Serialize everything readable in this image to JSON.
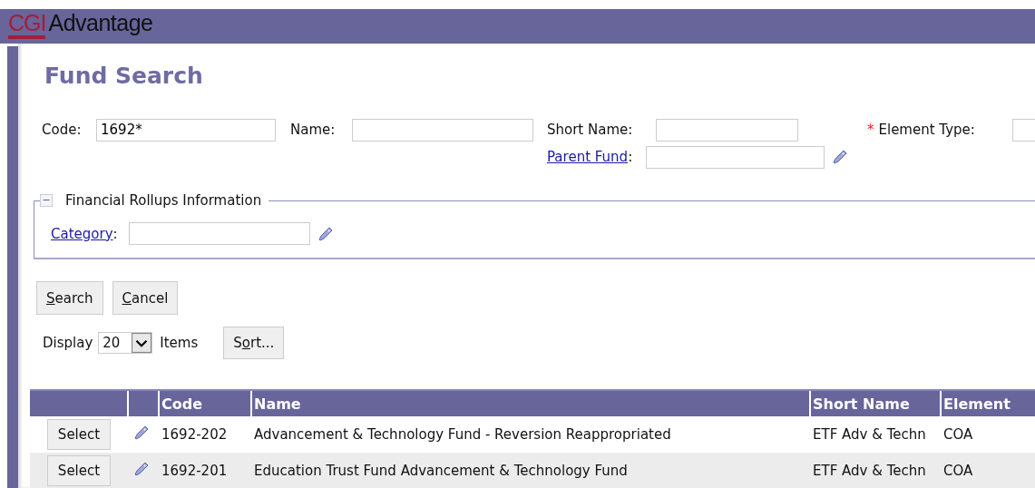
{
  "header": {
    "logo": "CGI",
    "product": "Advantage"
  },
  "title": "Fund Search",
  "search_fields": [
    {
      "kind": "text",
      "label": "Code:",
      "value": "1692*"
    },
    {
      "kind": "text",
      "label": "Name:"
    },
    {
      "kind": "text",
      "label": "Short Name:"
    },
    {
      "kind": "text",
      "label": "Element Type:",
      "required_mark": "*"
    }
  ],
  "second_row_fields": [
    {
      "kind": "link",
      "label": "Parent Fund",
      "suffix": ":",
      "lookup": true
    }
  ],
  "section": {
    "title": "Financial Rollups Information",
    "expanded": true,
    "toggle": "−",
    "fields": [
      {
        "kind": "link",
        "label": "Category",
        "suffix": ":",
        "lookup": true
      }
    ]
  },
  "buttons": [
    {
      "key": "S",
      "post": "earch"
    },
    {
      "key": "C",
      "post": "ancel"
    }
  ],
  "display": {
    "pre": "Display",
    "value": "20",
    "post": "Items",
    "sort_button": {
      "pre": "S",
      "key": "o",
      "post": "rt..."
    }
  },
  "table": {
    "columns": [
      "",
      "",
      "Code",
      "Name",
      "Short Name",
      "Element"
    ],
    "rows": [
      {
        "action": "Select",
        "code": "1692-202",
        "name": "Advancement & Technology Fund - Reversion Reappropriated",
        "short_name": "ETF Adv & Techn",
        "element": "COA",
        "shaded": false
      },
      {
        "action": "Select",
        "code": "1692-201",
        "name": "Education Trust Fund Advancement & Technology Fund",
        "short_name": "ETF Adv & Techn",
        "element": "COA",
        "shaded": true
      }
    ]
  }
}
